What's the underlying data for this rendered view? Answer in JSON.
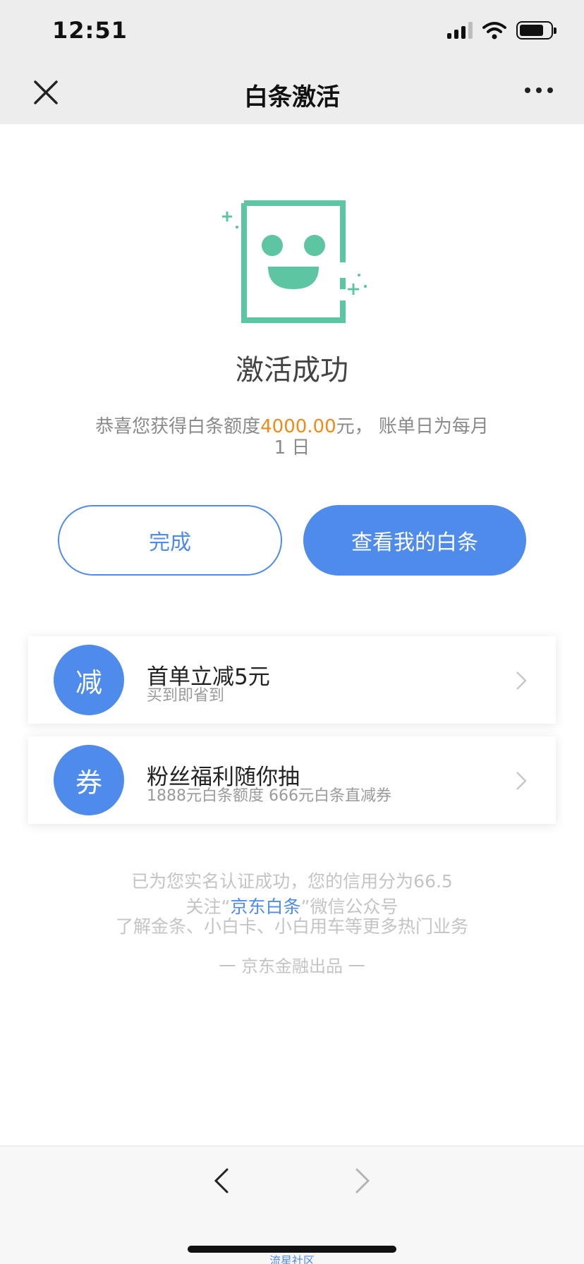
{
  "status_bar": {
    "time": "12:51",
    "icons": [
      "signal-icon",
      "wifi-icon",
      "battery-icon"
    ]
  },
  "nav": {
    "title": "白条激活",
    "close_icon": "close-icon",
    "more_icon": "more-icon"
  },
  "result": {
    "title": "激活成功",
    "desc_prefix": "恭喜您获得白条额度",
    "amount": "4000.00",
    "desc_suffix": "元， 账单日为每月1 日"
  },
  "buttons": {
    "done": "完成",
    "view": "查看我的白条"
  },
  "promos": [
    {
      "badge": "减",
      "title": "首单立减5元",
      "subtitle": "买到即省到"
    },
    {
      "badge": "券",
      "title": "粉丝福利随你抽",
      "subtitle": "1888元白条额度 666元白条直减券"
    }
  ],
  "footer": {
    "line1": "已为您实名认证成功，您的信用分为66.5",
    "line2_prefix": "关注“",
    "line2_link": "京东白条",
    "line2_suffix": "”微信公众号",
    "line3": "了解金条、小白卡、小白用车等更多热门业务",
    "line4": "一 京东金融出品 一"
  },
  "watermark": "流星社区",
  "colors": {
    "accent": "#4f8beb",
    "success_icon": "#5ec5a3",
    "amount": "#f08a19"
  }
}
